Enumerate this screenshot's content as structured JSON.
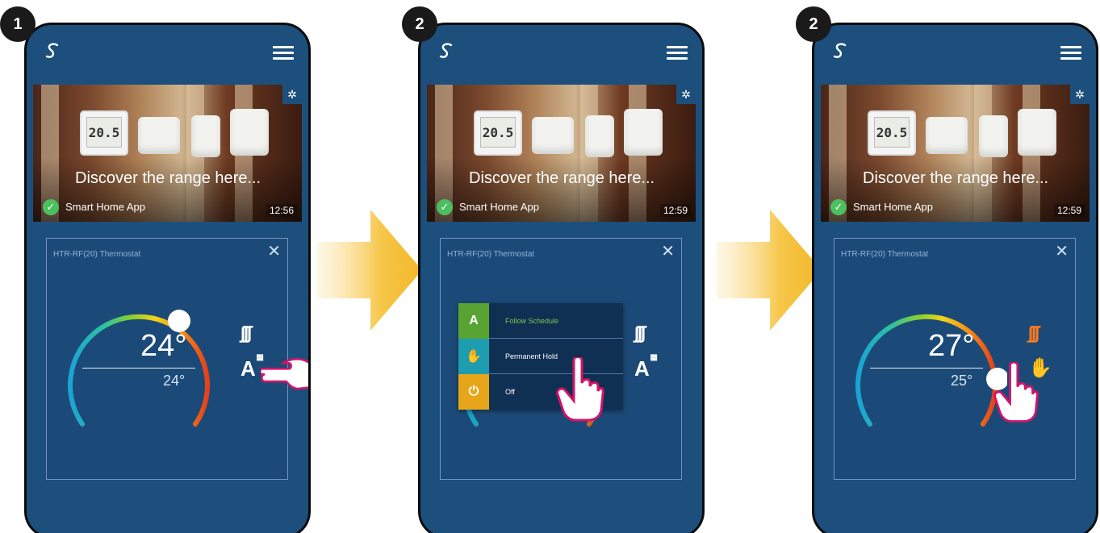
{
  "steps": [
    "1",
    "2",
    "2"
  ],
  "app": {
    "banner_title": "Discover the range here...",
    "app_name": "Smart Home App",
    "thermostat_display": "20.5"
  },
  "screens": [
    {
      "time": "12:56",
      "card_title": "HTR-RF(20) Thermostat",
      "setpoint": "24°",
      "current": "24°",
      "mode_icon": "auto-schedule-icon",
      "heat_color": "#ffffff"
    },
    {
      "time": "12:59",
      "card_title": "HTR-RF(20) Thermostat",
      "menu": [
        {
          "label": "Follow Schedule",
          "icon": "auto-schedule-icon",
          "color": "#58a331"
        },
        {
          "label": "Permanent Hold",
          "icon": "hand-icon",
          "color": "#1e9cb0"
        },
        {
          "label": "Off",
          "icon": "power-icon",
          "color": "#e7a51a"
        }
      ]
    },
    {
      "time": "12:59",
      "card_title": "HTR-RF(20) Thermostat",
      "setpoint": "27°",
      "current": "25°",
      "mode_icon": "hand-icon",
      "heat_color": "#ff7a1f"
    }
  ],
  "colors": {
    "phone_bg": "#1d4f7d",
    "arrow": "#f6c74a",
    "tap_hand_outline": "#d1146a"
  }
}
